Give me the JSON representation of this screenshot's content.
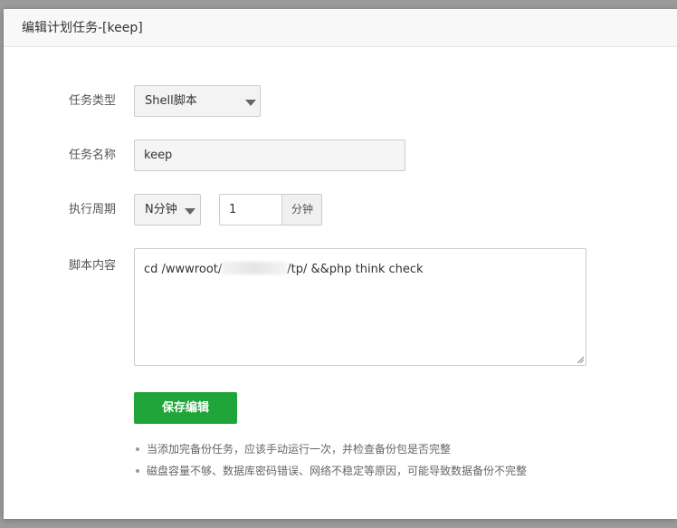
{
  "dialog": {
    "title": "编辑计划任务-[keep]"
  },
  "form": {
    "task_type": {
      "label": "任务类型",
      "value": "Shell脚本"
    },
    "task_name": {
      "label": "任务名称",
      "value": "keep"
    },
    "period": {
      "label": "执行周期",
      "unit_select": "N分钟",
      "interval_value": "1",
      "interval_unit": "分钟"
    },
    "script": {
      "label": "脚本内容",
      "prefix": "cd /wwwroot/",
      "suffix": "/tp/ &&php think check"
    },
    "save_label": "保存编辑"
  },
  "tips": [
    "当添加完备份任务，应该手动运行一次，并检查备份包是否完整",
    "磁盘容量不够、数据库密码错误、网络不稳定等原因，可能导致数据备份不完整"
  ],
  "colors": {
    "primary": "#20a53a",
    "header_bg": "#f8f8f8",
    "border": "#cccccc"
  },
  "icons": {
    "dropdown": "caret-down-icon",
    "resize": "resize-grip-icon",
    "tip": "bullet-dot-icon"
  }
}
